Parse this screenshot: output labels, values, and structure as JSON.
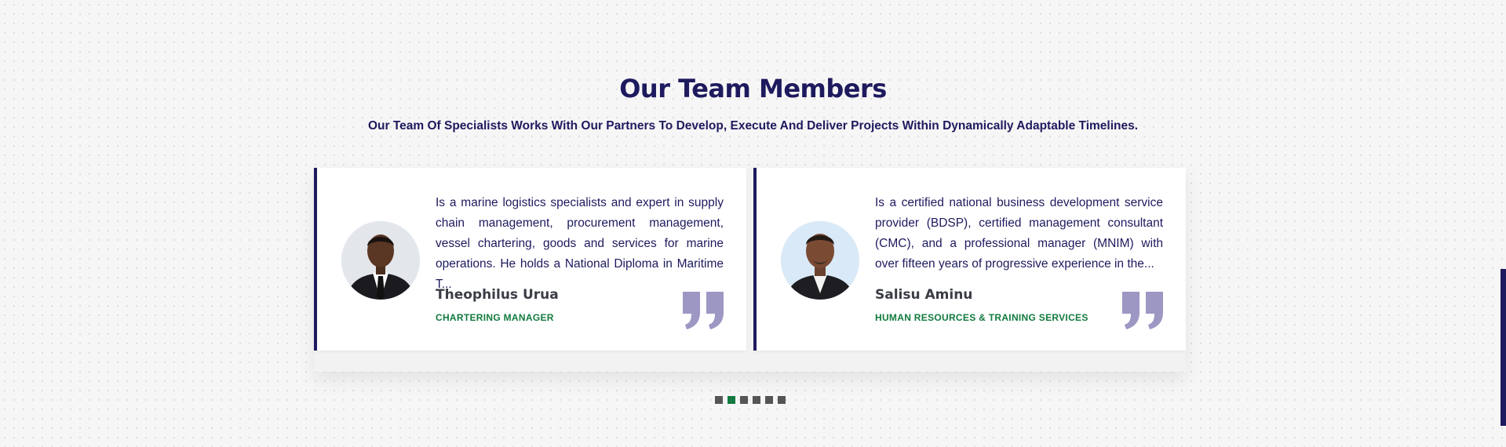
{
  "section": {
    "title": "Our Team Members",
    "subtitle": "Our Team Of Specialists Works With Our Partners To Develop, Execute And Deliver Projects Within Dynamically Adaptable Timelines."
  },
  "team": [
    {
      "bio": "Is a marine logistics specialists and expert in supply chain management, procurement management, vessel chartering, goods and services for marine operations. He holds a National Diploma in Maritime T...",
      "name": "Theophilus Urua",
      "role": "CHARTERING MANAGER"
    },
    {
      "bio": "Is a certified national business development service provider (BDSP), certified management consultant (CMC), and a professional manager (MNIM) with over fifteen years of progressive experience in the...",
      "name": "Salisu Aminu",
      "role": "HUMAN RESOURCES & TRAINING SERVICES"
    }
  ],
  "carousel": {
    "page_count": 6,
    "active_index": 1
  },
  "colors": {
    "primary": "#1e1a5e",
    "accent": "#127a3e",
    "quote": "#9d97c4",
    "dot_inactive": "#555555"
  },
  "icons": {
    "quote": "quote-mark-icon"
  }
}
